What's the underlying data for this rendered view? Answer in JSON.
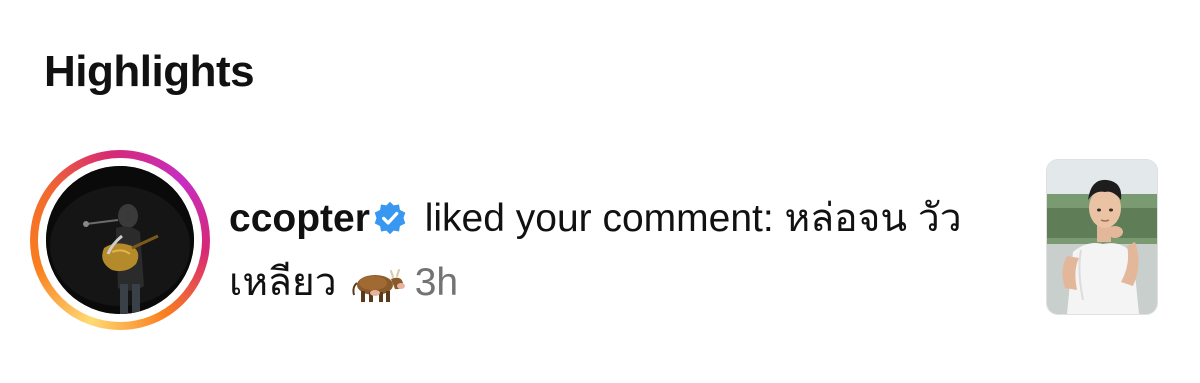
{
  "section": {
    "title": "Highlights"
  },
  "notification": {
    "username": "ccopter",
    "verified": true,
    "action_text": " liked your comment: หล่อจน วัวเหลียว",
    "emoji": "cow-emoji",
    "time": "3h"
  },
  "colors": {
    "verified_badge": "#3897f0",
    "time_text": "#737373",
    "story_ring_start": "#feda75",
    "story_ring_end": "#d62976"
  }
}
